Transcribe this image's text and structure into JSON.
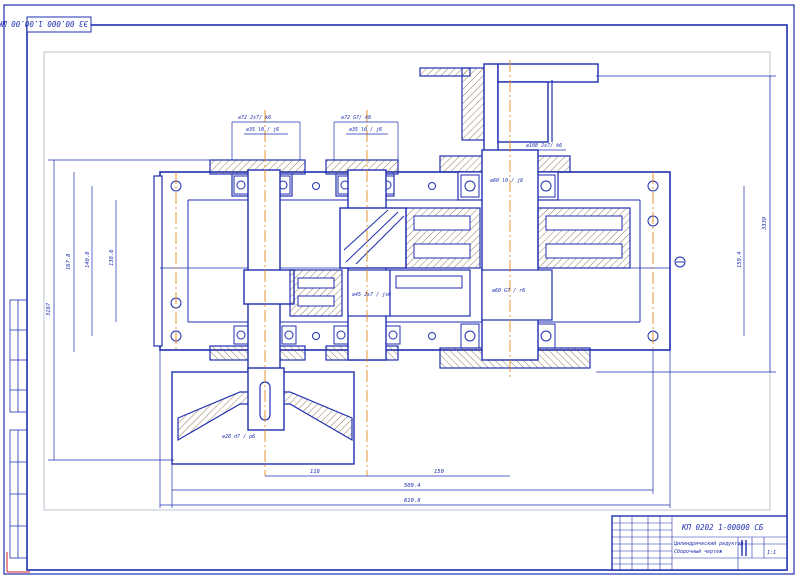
{
  "sheet": {
    "corner_code": "ЭЗ 00.000 1.00.00 ШК",
    "title_code": "КП 0202 1-00000 СБ",
    "title_name_line1": "Цилиндрический редуктор",
    "title_name_line2": "Сборочный чертеж",
    "sheet_count": "1:1"
  },
  "dimensions": {
    "top_fit_1": "⌀72 Js7/ k6",
    "top_fit_1b": "⌀35 l0 / j6",
    "top_fit_2": "⌀72 G7/ k6",
    "top_fit_2b": "⌀35 l0 / j6",
    "top_fit_3": "⌀108 Js7/ k6",
    "shaft_fit": "⌀60 l0 / j6",
    "mid_fit": "⌀60 G7 / r6",
    "center_fit": "⌀45 Js7 / js6",
    "bottom_fit": "⌀28 d7 / p6",
    "vert_left_1": "167.8",
    "vert_left_2": "140.8",
    "vert_left_3": "138.6",
    "vert_total_left": "3167",
    "vert_right_1": "3339",
    "vert_right_2": "159.4",
    "hor_1": "118",
    "hor_2": "150",
    "hor_3": "509.4",
    "hor_4": "610.8"
  },
  "colors": {
    "line": "#1f2fb0",
    "thin": "#2f6fe0",
    "hatch": "#7a5a2a",
    "axis": "#e08a1c",
    "sketch": "#6a8aa0"
  }
}
